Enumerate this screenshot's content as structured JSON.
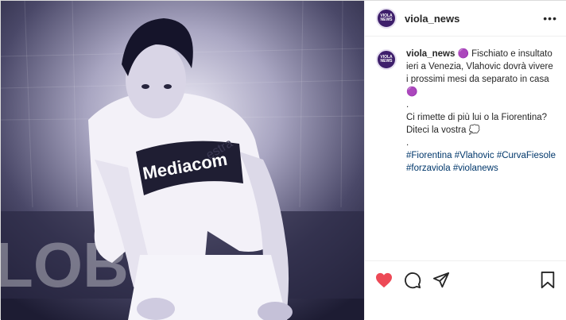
{
  "account": {
    "username": "viola_news",
    "avatar_text": "VIOLA NEWS"
  },
  "header": {
    "more_label": "•••"
  },
  "caption": {
    "username": "viola_news",
    "line1": "🟣 Fischiato e insultato ieri a Venezia, Vlahovic dovrà vivere i prossimi mesi da separato in casa 🟣",
    "dot1": ".",
    "line2": "Ci rimette di più lui o la Fiorentina? Diteci la vostra 💭",
    "dot2": ".",
    "hashtags": [
      "#Fiorentina",
      "#Vlahovic",
      "#CurvaFiesole",
      "#forzaviola",
      "#violanews"
    ]
  },
  "photo": {
    "shirt_text": "Mediacom",
    "sponsor_text": "estra",
    "board_text": "LOBE",
    "icons": [
      "player-photo"
    ]
  },
  "actions": {
    "icons": [
      "heart-icon",
      "comment-icon",
      "share-icon",
      "bookmark-icon"
    ],
    "like_color": "#ed4956"
  }
}
